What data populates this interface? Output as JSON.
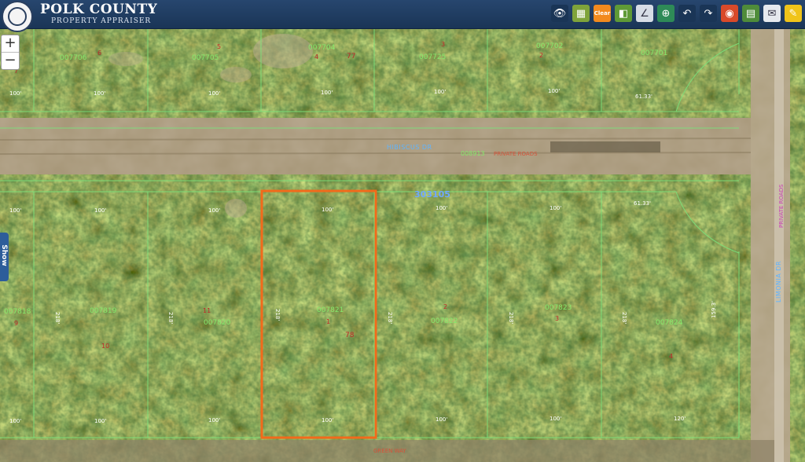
{
  "header": {
    "title": "POLK COUNTY",
    "subtitle": "PROPERTY APPRAISER"
  },
  "toolbar": [
    {
      "name": "binoculars-icon",
      "glyph": "👁",
      "bg": "#1a3556"
    },
    {
      "name": "grid-icon",
      "glyph": "▦",
      "bg": "#7fa33a"
    },
    {
      "name": "clear-icon",
      "glyph": "Clear",
      "bg": "#f28a1e"
    },
    {
      "name": "layers-icon",
      "glyph": "◧",
      "bg": "#5f9a36"
    },
    {
      "name": "measure-icon",
      "glyph": "∠",
      "bg": "#d7dde6"
    },
    {
      "name": "zoom-map-icon",
      "glyph": "⊕",
      "bg": "#2e8b57"
    },
    {
      "name": "undo-icon",
      "glyph": "↶",
      "bg": "#1a3556"
    },
    {
      "name": "redo-icon",
      "glyph": "↷",
      "bg": "#1a3556"
    },
    {
      "name": "legend-icon",
      "glyph": "◉",
      "bg": "#d94a2a"
    },
    {
      "name": "report-icon",
      "glyph": "▤",
      "bg": "#4f8c3a"
    },
    {
      "name": "email-icon",
      "glyph": "✉",
      "bg": "#e6e9ee"
    },
    {
      "name": "edit-icon",
      "glyph": "✎",
      "bg": "#f0c419"
    }
  ],
  "zoom": {
    "in": "+",
    "out": "−"
  },
  "side_tab": {
    "label": "Show"
  },
  "map": {
    "streets": [
      "HIBISCUS DR",
      "LIMONIA DR",
      "GREEN WAY"
    ],
    "road_parcel": {
      "id": "008913",
      "note": "PRIVATE ROADS"
    },
    "sheet_number": "303105",
    "parcels": [
      {
        "id": "007706",
        "frontage": "100'"
      },
      {
        "id": "007705",
        "frontage": "100'"
      },
      {
        "id": "007704",
        "frontage": "100'",
        "tag": "77"
      },
      {
        "id": "007725",
        "frontage": "100'"
      },
      {
        "id": "007702",
        "frontage": "100'"
      },
      {
        "id": "007701",
        "frontage": "61.33'"
      },
      {
        "id": "007818",
        "frontage": "100'"
      },
      {
        "id": "007819",
        "frontage": "100'"
      },
      {
        "id": "007820",
        "frontage": "100'"
      },
      {
        "id": "007821",
        "frontage": "100'",
        "tag": "78",
        "selected": true
      },
      {
        "id": "007822",
        "frontage": "100'"
      },
      {
        "id": "007823",
        "frontage": "100'"
      },
      {
        "id": "007824",
        "frontage": "61.33'"
      }
    ],
    "dimensions": [
      "218'",
      "159.3'",
      "120'"
    ],
    "colors": {
      "parcel_line": "#7be27b",
      "selected_outline": "#f26a1b",
      "lot_number": "#c0282a",
      "parcel_id": "#86e86b"
    }
  }
}
